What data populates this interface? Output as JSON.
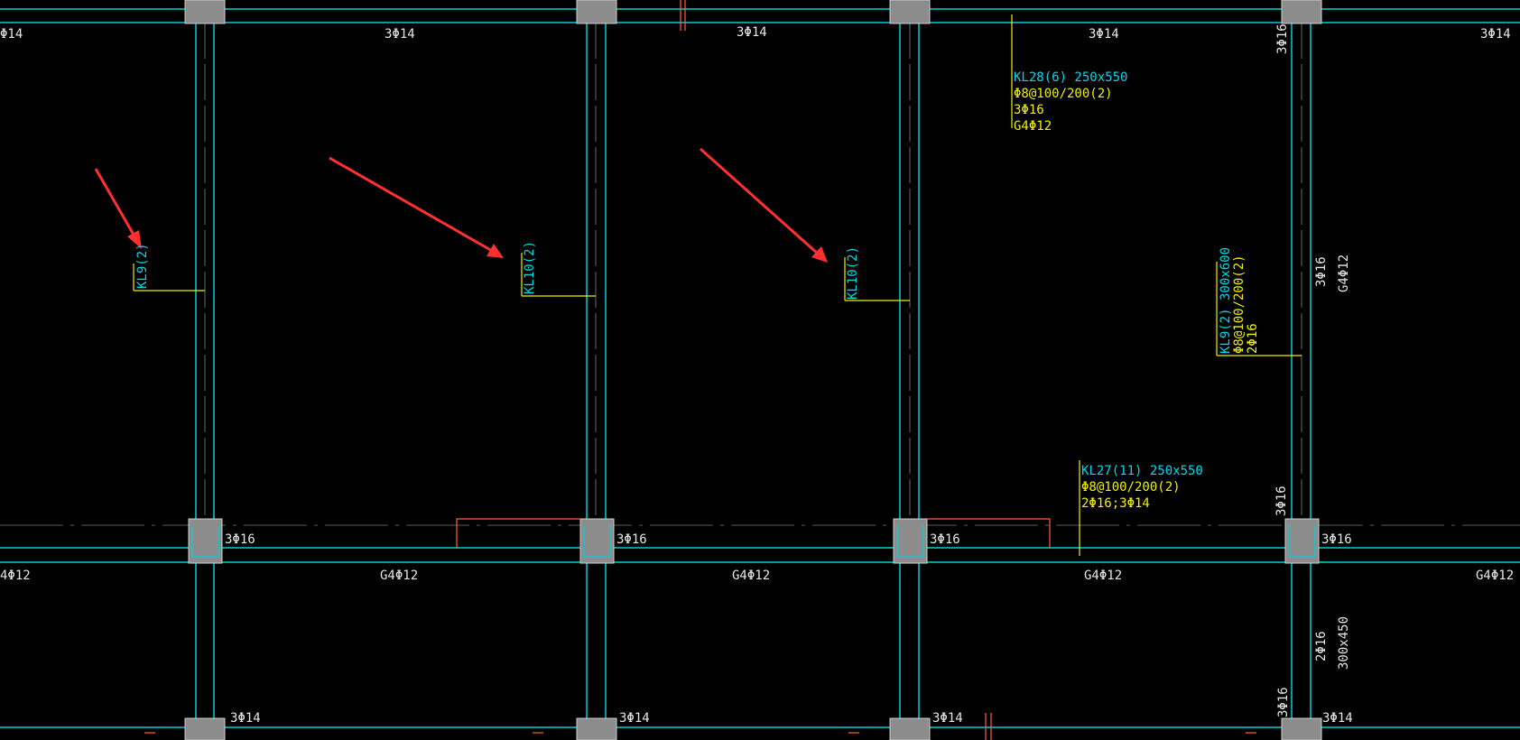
{
  "colors": {
    "background": "#000000",
    "beam_line": "#00d0d8",
    "beam_label": "#00d8e8",
    "rebar_note": "#f0f000",
    "column_fill": "#8c8c8c",
    "arrow": "#ff3030",
    "red_detail": "#ff6040",
    "leader_line": "#f0f000"
  },
  "annotations": {
    "top_left_rebar": "Φ14",
    "top_span1_rebar": "3Φ14",
    "top_span2_rebar": "3Φ14",
    "top_span3_rebar": "3Φ14",
    "top_right_rebar": "3Φ14",
    "right_vertical_top_rebar": "3Φ16",
    "kl28": {
      "name": "KL28(6) 250x550",
      "stirrup": "Φ8@100/200(2)",
      "top_rebar": "3Φ16",
      "side_rebar": "G4Φ12"
    },
    "kl9_left": "KL9(2)",
    "kl10_a": "KL10(2)",
    "kl10_b": "KL10(2)",
    "kl9_right": {
      "name": "KL9(2) 300x600",
      "stirrup": "Φ8@100/200(2)",
      "top_rebar": "2Φ16"
    },
    "right_side_top_rebar": "3Φ16",
    "right_side_side_rebar": "G4Φ12",
    "kl27": {
      "name": "KL27(11) 250x550",
      "stirrup": "Φ8@100/200(2)",
      "top_rebar": "2Φ16;3Φ14"
    },
    "mid_col_right_vertical": "3Φ16",
    "mid_rebar_col1": "3Φ16",
    "mid_rebar_col2": "3Φ16",
    "mid_rebar_col3": "3Φ16",
    "mid_rebar_col4": "3Φ16",
    "side_left": "4Φ12",
    "side_span1": "G4Φ12",
    "side_span2": "G4Φ12",
    "side_span3": "G4Φ12",
    "side_right": "G4Φ12",
    "bottom_right_vertical_rebar": "2Φ16",
    "bottom_right_vertical_size": "300x450",
    "bottom_right_vertical_small": "3Φ16",
    "bot_rebar_col1": "3Φ14",
    "bot_rebar_col2": "3Φ14",
    "bot_rebar_col3": "3Φ14",
    "bot_rebar_col4": "3Φ14"
  }
}
